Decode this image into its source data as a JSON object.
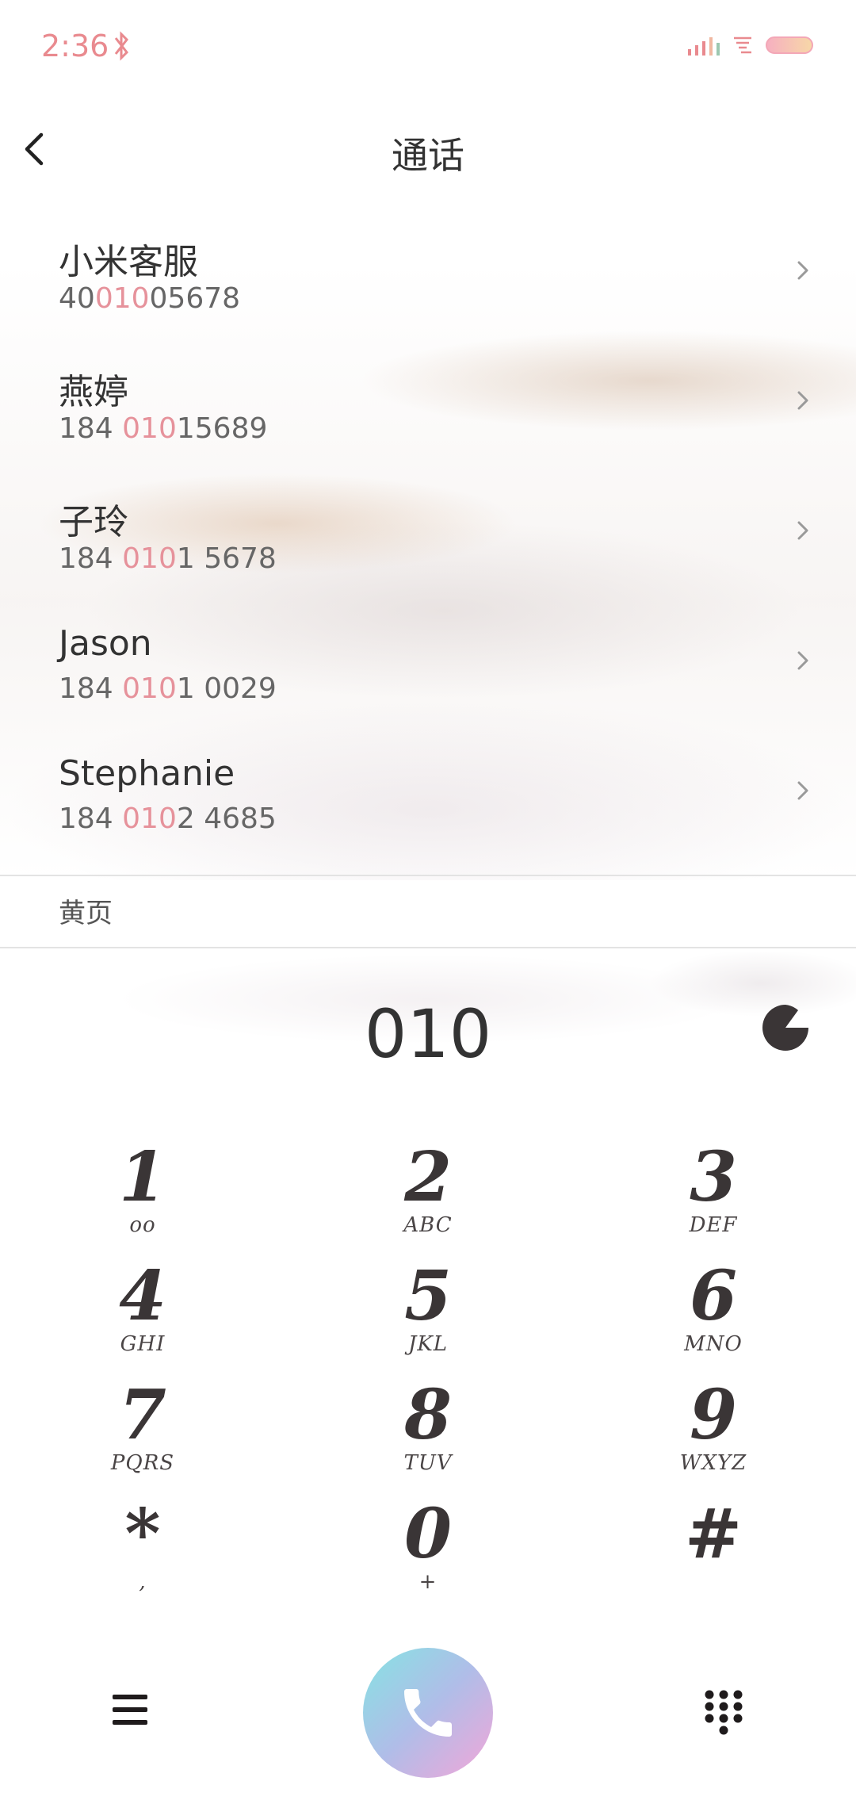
{
  "status_bar": {
    "time": "2:36",
    "icons": [
      "bluetooth-icon",
      "signal-icon",
      "wifi-icon",
      "battery-icon"
    ],
    "time_color": "#e98a8f"
  },
  "header": {
    "title": "通话",
    "back_icon": "back-chevron-icon"
  },
  "contacts": [
    {
      "name": "小米客服",
      "number_pre": "40",
      "number_hl": "010",
      "number_post": "05678"
    },
    {
      "name": "燕婷",
      "number_pre": "184 ",
      "number_hl": "010",
      "number_post": "15689"
    },
    {
      "name": "子玲",
      "number_pre": "184 ",
      "number_hl": "010",
      "number_post": "1 5678"
    },
    {
      "name": "Jason",
      "number_pre": "184 ",
      "number_hl": "010",
      "number_post": "1 0029"
    },
    {
      "name": "Stephanie",
      "number_pre": "184 ",
      "number_hl": "010",
      "number_post": "2 4685"
    }
  ],
  "highlight_color": "#e6929b",
  "yellow_pages": "黄页",
  "dial_input": "010",
  "keypad": [
    {
      "digit": "1",
      "letters": "ᴏᴏ"
    },
    {
      "digit": "2",
      "letters": "ABC"
    },
    {
      "digit": "3",
      "letters": "DEF"
    },
    {
      "digit": "4",
      "letters": "GHI"
    },
    {
      "digit": "5",
      "letters": "JKL"
    },
    {
      "digit": "6",
      "letters": "MNO"
    },
    {
      "digit": "7",
      "letters": "PQRS"
    },
    {
      "digit": "8",
      "letters": "TUV"
    },
    {
      "digit": "9",
      "letters": "WXYZ"
    },
    {
      "digit": "*",
      "letters": ","
    },
    {
      "digit": "0",
      "letters": "+"
    },
    {
      "digit": "#",
      "letters": ""
    }
  ],
  "bottom_bar": {
    "menu_icon": "hamburger-menu-icon",
    "call_icon": "phone-icon",
    "dialpad_icon": "dialpad-icon",
    "call_gradient": [
      "#86e3e3",
      "#f3a6d8"
    ]
  }
}
